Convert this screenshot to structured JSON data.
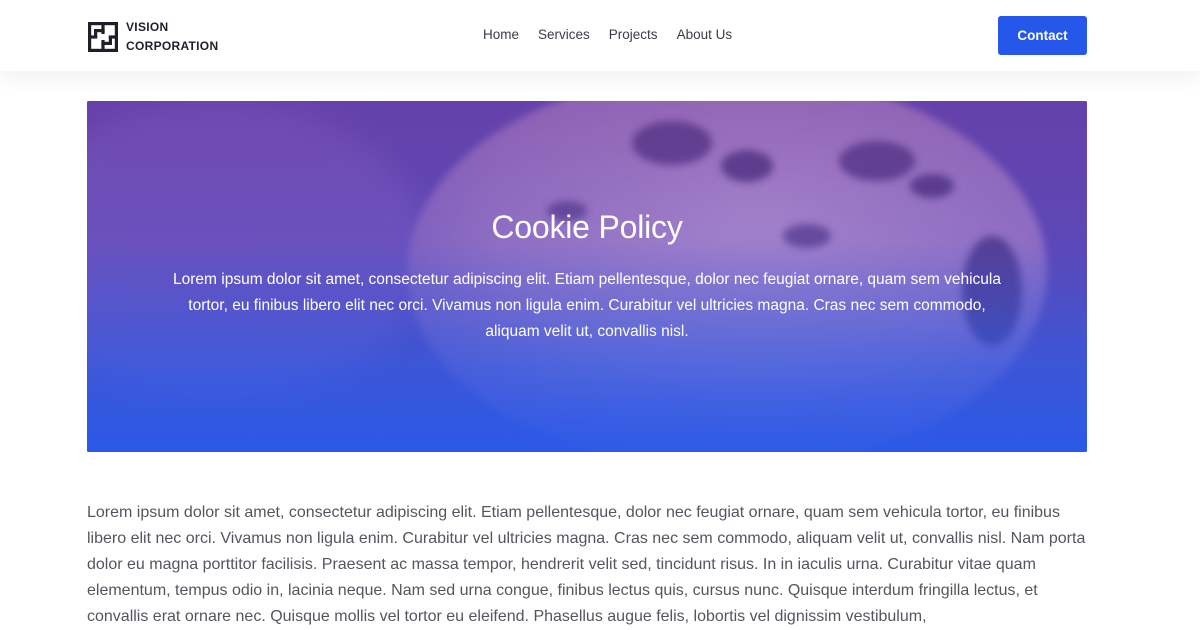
{
  "header": {
    "logo": {
      "icon": "vision-corporation-logo-mark",
      "line1": "VISION",
      "line2": "CORPORATION"
    },
    "nav": [
      {
        "label": "Home"
      },
      {
        "label": "Services"
      },
      {
        "label": "Projects"
      },
      {
        "label": "About Us"
      }
    ],
    "contact_label": "Contact"
  },
  "hero": {
    "title": "Cookie Policy",
    "text": "Lorem ipsum dolor sit amet, consectetur adipiscing elit. Etiam pellentesque, dolor nec feugiat ornare, quam sem vehicula tortor, eu finibus libero elit nec orci. Vivamus non ligula enim. Curabitur vel ultricies magna. Cras nec sem commodo, aliquam velit ut, convallis nisl.",
    "background": "cookie-photo"
  },
  "body": {
    "paragraph": "Lorem ipsum dolor sit amet, consectetur adipiscing elit. Etiam pellentesque, dolor nec feugiat ornare, quam sem vehicula tortor, eu finibus libero elit nec orci. Vivamus non ligula enim. Curabitur vel ultricies magna. Cras nec sem commodo, aliquam velit ut, convallis nisl. Nam porta dolor eu magna porttitor facilisis. Praesent ac massa tempor, hendrerit velit sed, tincidunt risus. In in iaculis urna. Curabitur vitae quam elementum, tempus odio in, lacinia neque. Nam sed urna congue, finibus lectus quis, cursus nunc. Quisque interdum fringilla lectus, et convallis erat ornare nec. Quisque mollis vel tortor eu eleifend. Phasellus augue felis, lobortis vel dignissim vestibulum,"
  },
  "colors": {
    "accent": "#2457ea",
    "hero_top": "#6e3caa",
    "hero_bottom": "#285aeb",
    "text": "#55555f"
  }
}
